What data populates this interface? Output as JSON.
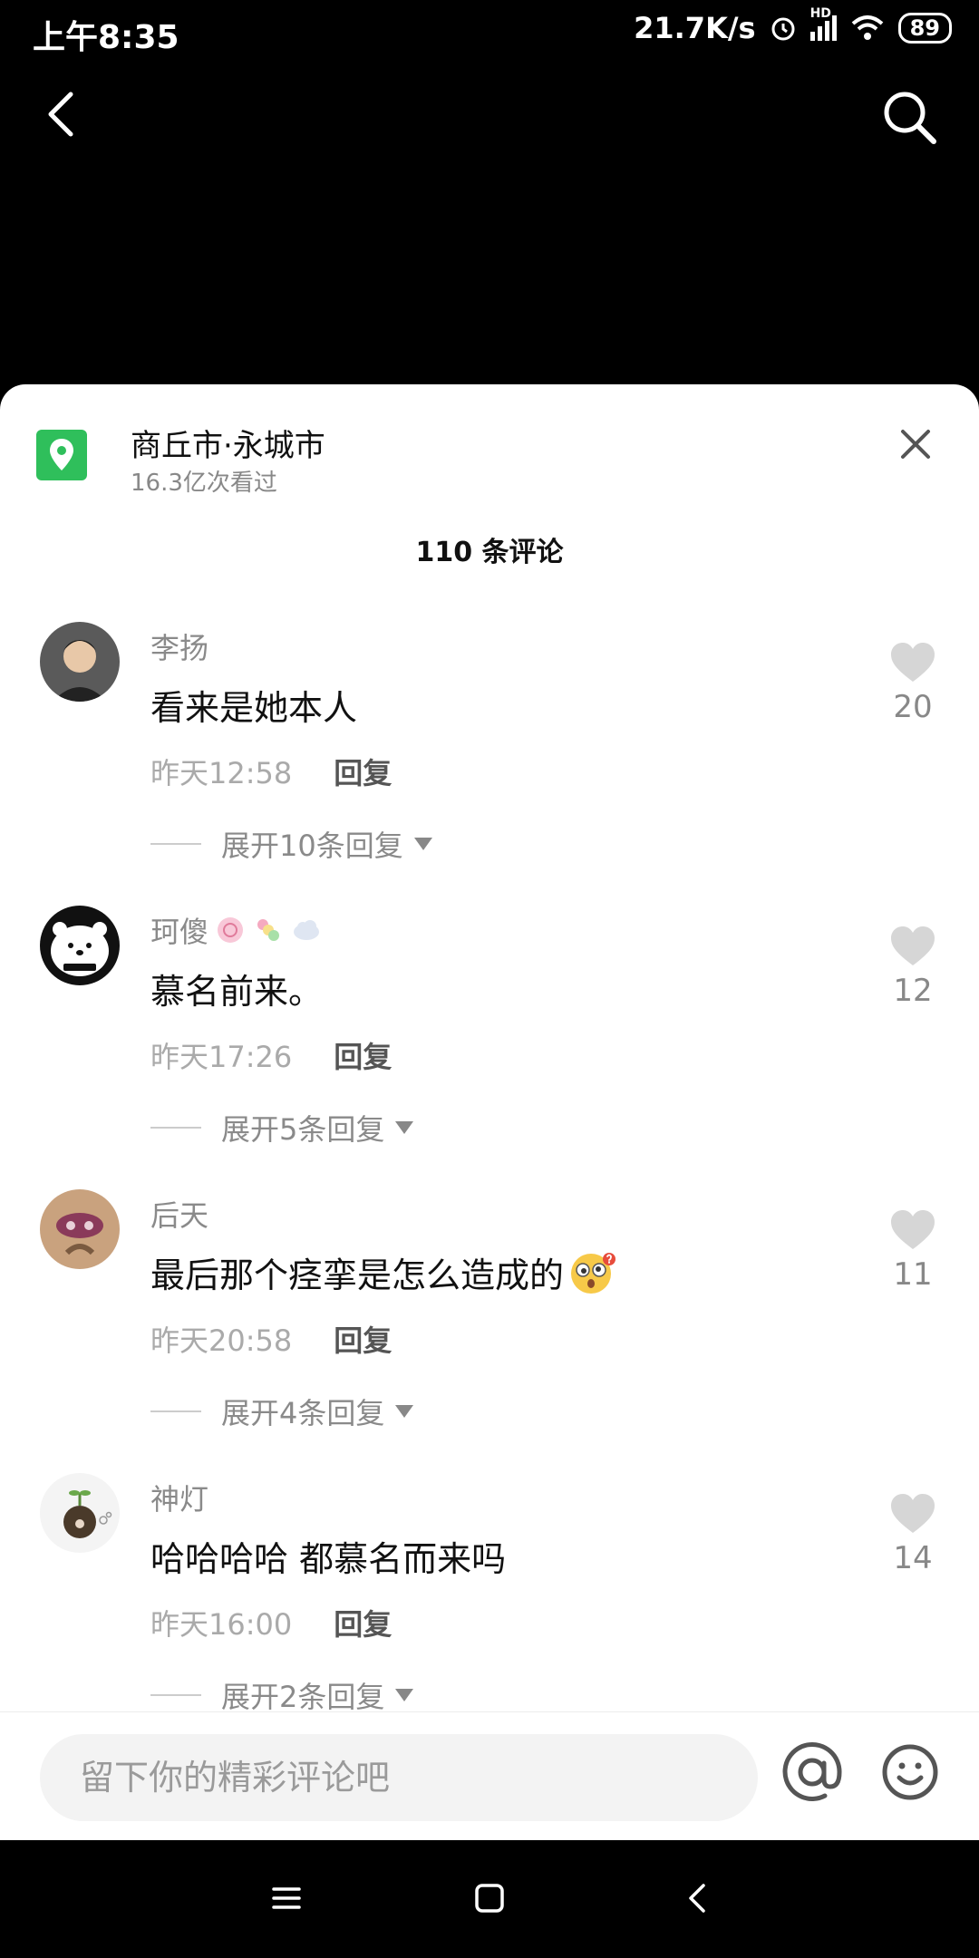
{
  "status": {
    "time": "上午8:35",
    "speed": "21.7K/s",
    "network": "HD",
    "battery": "89"
  },
  "location": {
    "name": "商丘市·永城市",
    "views": "16.3亿次看过"
  },
  "comment_count": "110 条评论",
  "comments": [
    {
      "user": "李扬",
      "text": "看来是她本人",
      "time": "昨天12:58",
      "reply": "回复",
      "expand": "展开10条回复",
      "likes": "20"
    },
    {
      "user": "珂傻",
      "text": "慕名前来。",
      "time": "昨天17:26",
      "reply": "回复",
      "expand": "展开5条回复",
      "likes": "12"
    },
    {
      "user": "后天",
      "text": "最后那个痉挛是怎么造成的",
      "time": "昨天20:58",
      "reply": "回复",
      "expand": "展开4条回复",
      "likes": "11"
    },
    {
      "user": "神灯",
      "text": "哈哈哈哈 都慕名而来吗",
      "time": "昨天16:00",
      "reply": "回复",
      "expand": "展开2条回复",
      "likes": "14"
    }
  ],
  "input": {
    "placeholder": "留下你的精彩评论吧"
  },
  "icons": {
    "back": "chevron-left-icon",
    "search": "search-icon",
    "location": "location-pin-icon",
    "close": "close-icon",
    "like": "heart-icon",
    "at": "at-icon",
    "emoji": "smiley-icon"
  },
  "colors": {
    "location_green": "#2fbf5b",
    "sheet_bg": "#ffffff",
    "top_bg": "#000000"
  }
}
